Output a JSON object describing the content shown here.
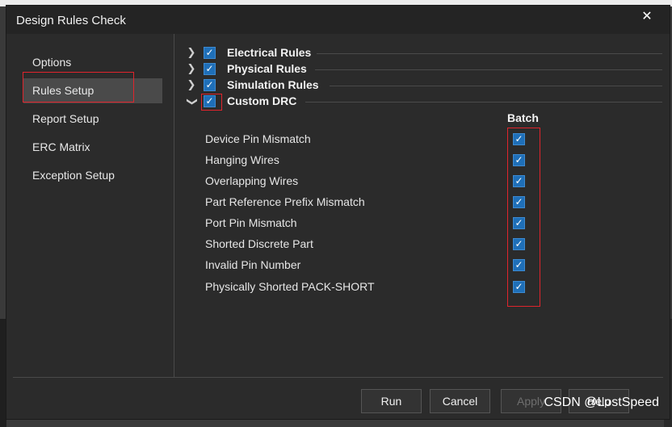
{
  "window": {
    "title": "Design Rules Check",
    "close_glyph": "✕"
  },
  "sidebar": {
    "items": [
      {
        "label": "Options",
        "active": false
      },
      {
        "label": "Rules Setup",
        "active": true
      },
      {
        "label": "Report Setup",
        "active": false
      },
      {
        "label": "ERC Matrix",
        "active": false
      },
      {
        "label": "Exception Setup",
        "active": false
      }
    ]
  },
  "rules": [
    {
      "label": "Electrical Rules",
      "checked": true,
      "expanded": false
    },
    {
      "label": "Physical Rules",
      "checked": true,
      "expanded": false
    },
    {
      "label": "Simulation Rules",
      "checked": true,
      "expanded": false
    },
    {
      "label": "Custom DRC",
      "checked": true,
      "expanded": true
    }
  ],
  "custom_drc": {
    "column_header": "Batch",
    "items": [
      {
        "label": "Device Pin Mismatch",
        "batch": true
      },
      {
        "label": "Hanging Wires",
        "batch": true
      },
      {
        "label": "Overlapping Wires",
        "batch": true
      },
      {
        "label": "Part Reference Prefix Mismatch",
        "batch": true
      },
      {
        "label": "Port Pin Mismatch",
        "batch": true
      },
      {
        "label": "Shorted Discrete Part",
        "batch": true
      },
      {
        "label": "Invalid Pin Number",
        "batch": true
      },
      {
        "label": "Physically Shorted PACK-SHORT",
        "batch": true
      }
    ]
  },
  "buttons": {
    "run": "Run",
    "cancel": "Cancel",
    "apply": "Apply",
    "help": "Help"
  },
  "watermark": "CSDN @LostSpeed",
  "icons": {
    "collapsed": "chevron-right-icon",
    "expanded": "chevron-down-icon",
    "check": "checkmark-icon"
  },
  "colors": {
    "checkbox": "#1f6fb8",
    "highlight": "#e0242c",
    "active_nav": "#4a4a4a",
    "dialog_bg": "#2b2b2b"
  }
}
